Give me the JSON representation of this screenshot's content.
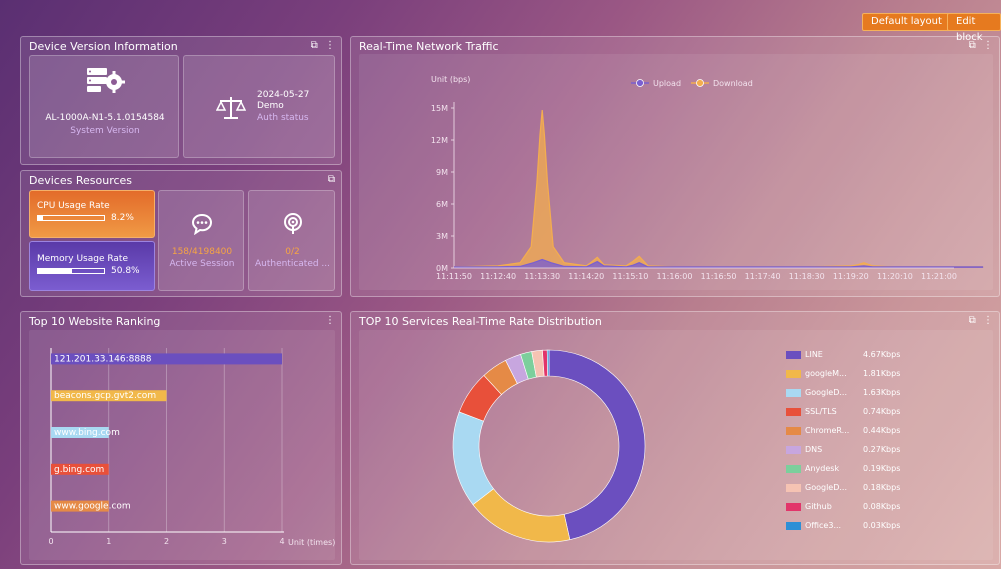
{
  "toolbar": {
    "default_layout": "Default layout",
    "edit_block": "Edit block"
  },
  "device_version": {
    "title": "Device Version Information",
    "version_value": "AL-1000A-N1-5.1.0154584",
    "version_label": "System Version",
    "auth_date": "2024-05-27",
    "auth_type": "Demo",
    "auth_label": "Auth status"
  },
  "devices_resources": {
    "title": "Devices Resources",
    "cpu": {
      "label": "CPU Usage Rate",
      "value": "8.2%",
      "fraction": 0.082
    },
    "memory": {
      "label": "Memory Usage Rate",
      "value": "50.8%",
      "fraction": 0.508
    },
    "session": {
      "value": "158/4198400",
      "label": "Active Session"
    },
    "auth_users": {
      "value": "0/2",
      "label": "Authenticated ..."
    }
  },
  "network_traffic": {
    "title": "Real-Time Network Traffic",
    "chart_data": {
      "type": "line",
      "ylabel": "Unit (bps)",
      "y_ticks": [
        "15M",
        "12M",
        "9M",
        "6M",
        "3M",
        "0M"
      ],
      "ylim": [
        0,
        15
      ],
      "x_ticks": [
        "11:11:50",
        "11:12:40",
        "11:13:30",
        "11:14:20",
        "11:15:10",
        "11:16:00",
        "11:16:50",
        "11:17:40",
        "11:18:30",
        "11:19:20",
        "11:20:10",
        "11:21:00"
      ],
      "series": [
        {
          "name": "Upload",
          "color": "#7a5fd0",
          "x": [
            0,
            1,
            1.5,
            1.8,
            2.0,
            2.2,
            2.5,
            3,
            3.1,
            3.25,
            3.4,
            3.9,
            4.05,
            4.2,
            4.4,
            5,
            6,
            7,
            8,
            9,
            9.15,
            9.3,
            9.5,
            10,
            11,
            12
          ],
          "values": [
            0.1,
            0.1,
            0.15,
            0.5,
            0.8,
            0.5,
            0.15,
            0.1,
            0.3,
            0.6,
            0.2,
            0.1,
            0.25,
            0.5,
            0.1,
            0.1,
            0.1,
            0.1,
            0.1,
            0.1,
            0.15,
            0.2,
            0.1,
            0.1,
            0.1,
            0.1
          ]
        },
        {
          "name": "Download",
          "color": "#f4ad4e",
          "x": [
            0,
            1,
            1.5,
            1.75,
            1.88,
            1.95,
            2.0,
            2.05,
            2.12,
            2.25,
            2.5,
            3,
            3.1,
            3.25,
            3.4,
            3.9,
            4.05,
            4.2,
            4.4,
            5,
            6,
            7,
            8,
            9,
            9.15,
            9.3,
            9.5,
            10,
            11,
            12
          ],
          "values": [
            0.1,
            0.2,
            0.5,
            2.0,
            8.0,
            12.5,
            14.8,
            12.5,
            8.0,
            2.0,
            0.5,
            0.2,
            0.5,
            1.0,
            0.3,
            0.2,
            0.6,
            1.1,
            0.2,
            0.1,
            0.1,
            0.1,
            0.1,
            0.2,
            0.3,
            0.5,
            0.2,
            0.1,
            0.1,
            0.1
          ]
        }
      ]
    }
  },
  "website_ranking": {
    "title": "Top 10 Website Ranking",
    "chart_data": {
      "type": "bar",
      "orientation": "horizontal",
      "categories": [
        "121.201.33.146:8888",
        "beacons.gcp.gvt2.com",
        "www.bing.com",
        "g.bing.com",
        "www.google.com"
      ],
      "values": [
        4,
        2,
        1,
        1,
        1
      ],
      "colors": [
        "#6b4fbf",
        "#f1b84a",
        "#a9d9f2",
        "#e8503a",
        "#e58a46"
      ],
      "xlim": [
        0,
        4
      ],
      "x_ticks": [
        "0",
        "1",
        "2",
        "3",
        "4"
      ],
      "xlabel": "Unit (times)"
    }
  },
  "services_distribution": {
    "title": "TOP 10 Services Real-Time Rate Distribution",
    "chart_data": {
      "type": "pie",
      "labels": [
        "LINE",
        "googleM...",
        "GoogleD...",
        "SSL/TLS",
        "ChromeR...",
        "DNS",
        "Anydesk",
        "GoogleD...",
        "Github",
        "Office3..."
      ],
      "values": [
        4.67,
        1.81,
        1.63,
        0.74,
        0.44,
        0.27,
        0.19,
        0.18,
        0.08,
        0.03
      ],
      "value_labels": [
        "4.67Kbps",
        "1.81Kbps",
        "1.63Kbps",
        "0.74Kbps",
        "0.44Kbps",
        "0.27Kbps",
        "0.19Kbps",
        "0.18Kbps",
        "0.08Kbps",
        "0.03Kbps"
      ],
      "colors": [
        "#6b4fbf",
        "#f1b84a",
        "#a9d9f2",
        "#e8503a",
        "#e58a46",
        "#c7a6df",
        "#7ccf9c",
        "#f6c3b3",
        "#e2356a",
        "#2e8fd6"
      ]
    }
  }
}
